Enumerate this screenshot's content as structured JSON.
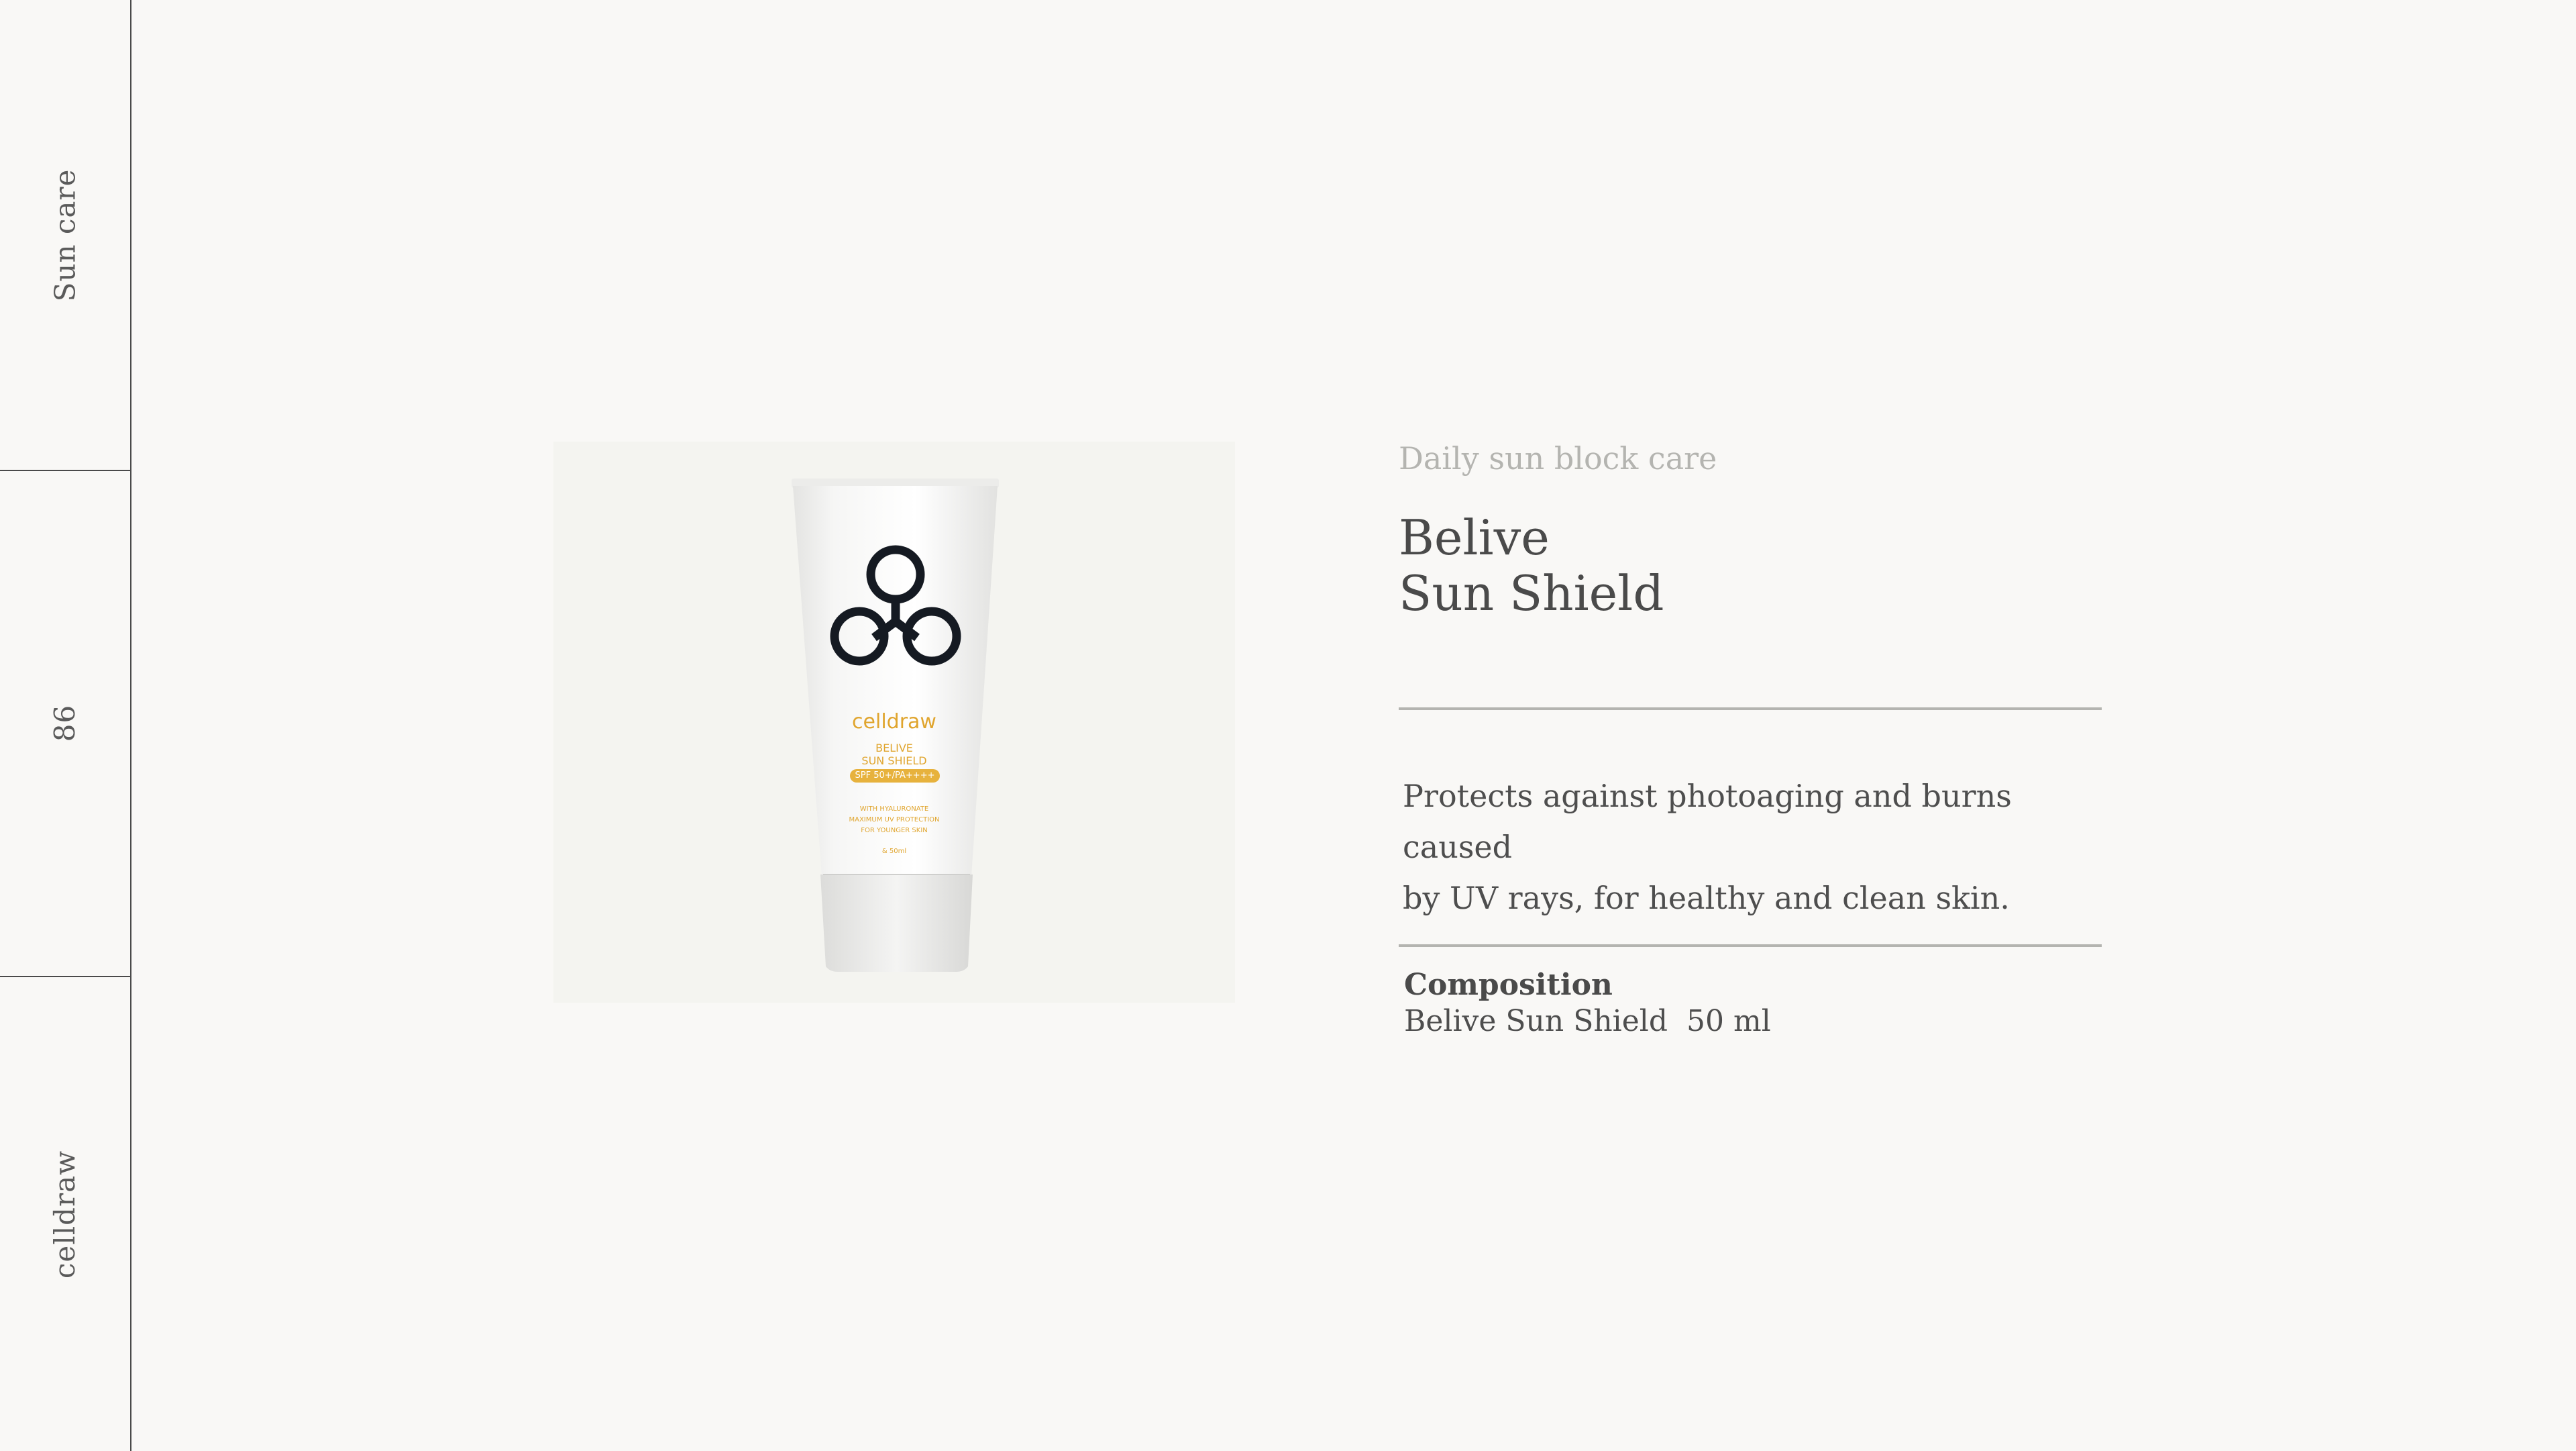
{
  "sidebar": {
    "labels": [
      "Sun care",
      "86",
      "celldraw"
    ]
  },
  "product": {
    "image_alt": "Belive Sun Shield tube",
    "tube_brand": "celldraw",
    "tube_name_line1": "BELIVE",
    "tube_name_line2": "SUN SHIELD",
    "tube_spf": "SPF 50+/PA++++",
    "tube_fine_lines": [
      "WITH HYALURONATE",
      "MAXIMUM UV PROTECTION",
      "FOR YOUNGER SKIN"
    ],
    "tube_volume": "& 50ml",
    "tube_color": "#e0a52e"
  },
  "content": {
    "subtitle": "Daily sun block care",
    "title_line1": "Belive",
    "title_line2": "Sun Shield",
    "description_line1": "Protects against photoaging and burns caused",
    "description_line2": "by UV rays, for healthy and clean skin.",
    "composition_heading": "Composition",
    "composition_item": "Belive Sun Shield",
    "composition_volume": "50 ml"
  }
}
